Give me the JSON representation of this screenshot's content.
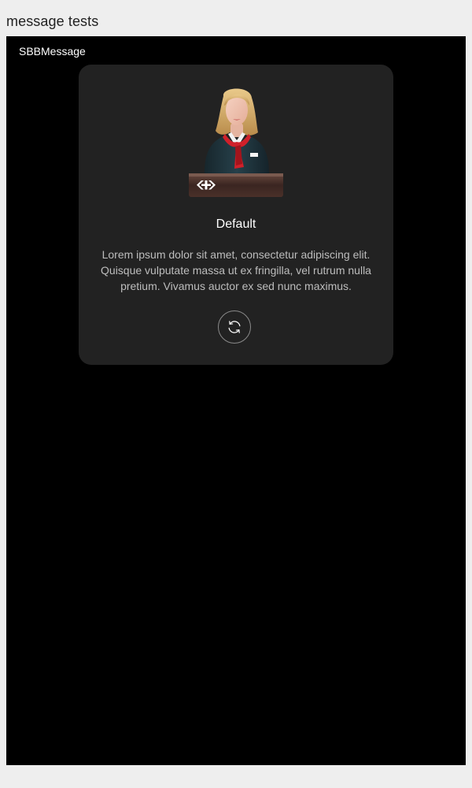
{
  "page": {
    "title": "message tests"
  },
  "frame": {
    "label": "SBBMessage"
  },
  "message": {
    "title": "Default",
    "text": "Lorem ipsum dolor sit amet, consectetur adipiscing elit. Quisque vulputate massa ut ex fringilla, vel rutrum nulla pretium. Vivamus auctor ex sed nunc maximus.",
    "image_icon": "station-attendant-illustration",
    "action_icon": "arrows-circle-icon"
  },
  "colors": {
    "page_background": "#eeeeee",
    "frame_background": "#000000",
    "card_background": "#222222",
    "accent_red": "#d8232a"
  }
}
